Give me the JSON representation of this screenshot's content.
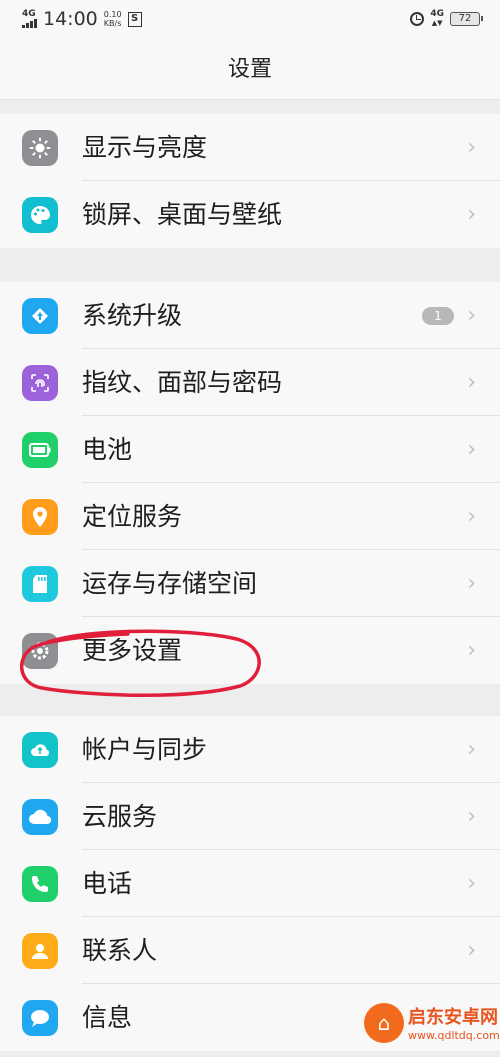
{
  "status_bar": {
    "network": "4G",
    "time": "14:00",
    "speed_value": "0.10",
    "speed_unit": "KB/s",
    "sim_icon_text": "S",
    "network_right": "4G",
    "battery": "72"
  },
  "header": {
    "title": "设置"
  },
  "groups": [
    {
      "items": [
        {
          "label": "显示与亮度",
          "icon": "sun-icon",
          "color": "#8e8e93"
        },
        {
          "label": "锁屏、桌面与壁纸",
          "icon": "palette-icon",
          "color": "#12bfd0"
        }
      ]
    },
    {
      "items": [
        {
          "label": "系统升级",
          "icon": "upgrade-icon",
          "color": "#1fa8f0",
          "badge": "1"
        },
        {
          "label": "指纹、面部与密码",
          "icon": "fingerprint-icon",
          "color": "#9b62d9"
        },
        {
          "label": "电池",
          "icon": "battery-icon",
          "color": "#1fcf6a"
        },
        {
          "label": "定位服务",
          "icon": "location-icon",
          "color": "#ff9d1a"
        },
        {
          "label": "运存与存储空间",
          "icon": "sd-card-icon",
          "color": "#1ec9dd"
        },
        {
          "label": "更多设置",
          "icon": "gear-icon",
          "color": "#8e8e93"
        }
      ]
    },
    {
      "items": [
        {
          "label": "帐户与同步",
          "icon": "account-sync-icon",
          "color": "#12c3c9"
        },
        {
          "label": "云服务",
          "icon": "cloud-icon",
          "color": "#1fa8f0"
        },
        {
          "label": "电话",
          "icon": "phone-icon",
          "color": "#1fcf6a"
        },
        {
          "label": "联系人",
          "icon": "contact-icon",
          "color": "#ffac1a"
        },
        {
          "label": "信息",
          "icon": "message-icon",
          "color": "#1fa8f0"
        }
      ]
    }
  ],
  "watermark": {
    "name": "启东安卓网",
    "url": "www.qdltdq.com"
  }
}
